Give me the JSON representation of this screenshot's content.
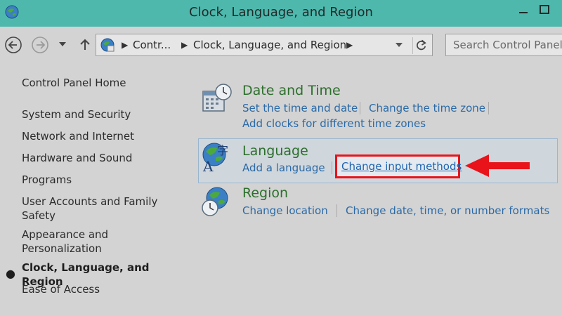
{
  "window": {
    "title": "Clock, Language, and Region",
    "accent_color": "#4fb8ad"
  },
  "nav": {
    "breadcrumbs": [
      "Contr...",
      "Clock, Language, and Region"
    ],
    "search_placeholder": "Search Control Panel"
  },
  "sidebar": {
    "items": [
      "Control Panel Home",
      "System and Security",
      "Network and Internet",
      "Hardware and Sound",
      "Programs",
      "User Accounts and Family Safety",
      "Appearance and Personalization",
      "Clock, Language, and Region",
      "Ease of Access"
    ],
    "active_item": "Clock, Language, and Region"
  },
  "categories": {
    "datetime": {
      "title": "Date and Time",
      "links": [
        "Set the time and date",
        "Change the time zone",
        "Add clocks for different time zones"
      ]
    },
    "language": {
      "title": "Language",
      "links": [
        "Add a language",
        "Change input methods"
      ]
    },
    "region": {
      "title": "Region",
      "links": [
        "Change location",
        "Change date, time, or number formats"
      ]
    }
  },
  "annotation": {
    "highlight_color": "#e8141a"
  }
}
